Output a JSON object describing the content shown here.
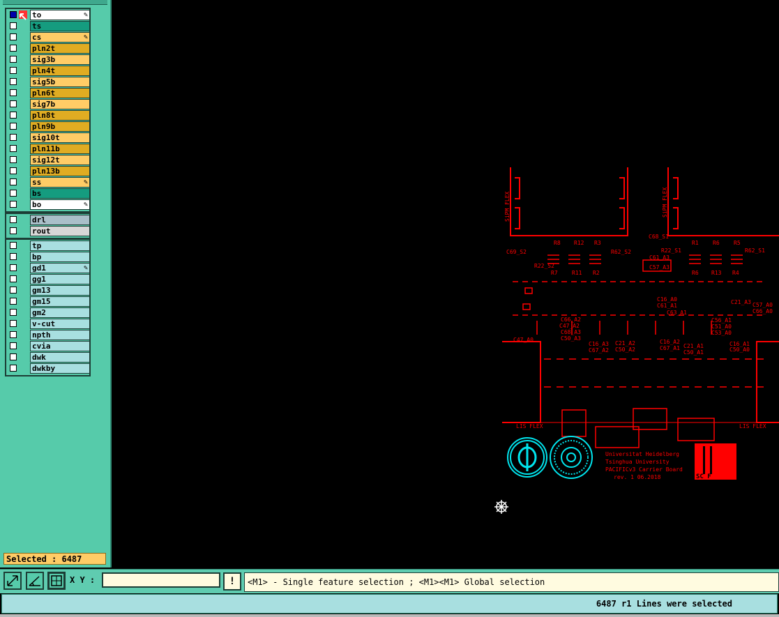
{
  "layers": {
    "board": [
      {
        "name": "to",
        "color": "white",
        "pen": true,
        "active": true
      },
      {
        "name": "ts",
        "color": "teal",
        "pen": false
      },
      {
        "name": "cs",
        "color": "orange1",
        "pen": true
      },
      {
        "name": "pln2t",
        "color": "orange2",
        "pen": false
      },
      {
        "name": "sig3b",
        "color": "orange1",
        "pen": false
      },
      {
        "name": "pln4t",
        "color": "orange2",
        "pen": false
      },
      {
        "name": "sig5b",
        "color": "orange1",
        "pen": false
      },
      {
        "name": "pln6t",
        "color": "orange2",
        "pen": false
      },
      {
        "name": "sig7b",
        "color": "orange1",
        "pen": false
      },
      {
        "name": "pln8t",
        "color": "orange2",
        "pen": false
      },
      {
        "name": "pln9b",
        "color": "orange2",
        "pen": false
      },
      {
        "name": "sig10t",
        "color": "orange1",
        "pen": false
      },
      {
        "name": "pln11b",
        "color": "orange2",
        "pen": false
      },
      {
        "name": "sig12t",
        "color": "orange1",
        "pen": false
      },
      {
        "name": "pln13b",
        "color": "orange2",
        "pen": false
      },
      {
        "name": "ss",
        "color": "orange1",
        "pen": true
      },
      {
        "name": "bs",
        "color": "teal",
        "pen": false
      },
      {
        "name": "bo",
        "color": "white",
        "pen": true
      }
    ],
    "drill": [
      {
        "name": "drl",
        "color": "gray"
      },
      {
        "name": "rout",
        "color": "lgray"
      }
    ],
    "misc": [
      {
        "name": "tp",
        "pen": false
      },
      {
        "name": "bp",
        "pen": false
      },
      {
        "name": "gd1",
        "pen": true
      },
      {
        "name": "gg1",
        "pen": false
      },
      {
        "name": "gm13",
        "pen": false
      },
      {
        "name": "gm15",
        "pen": false
      },
      {
        "name": "gm2",
        "pen": false
      },
      {
        "name": "v-cut",
        "pen": false
      },
      {
        "name": "npth",
        "pen": false
      },
      {
        "name": "cvia",
        "pen": false
      },
      {
        "name": "dwk",
        "pen": false
      },
      {
        "name": "dwkby",
        "pen": false
      }
    ]
  },
  "selected_label": "Selected : 6487",
  "toolbar": {
    "xy_label": "X Y :",
    "xy_value": "",
    "warn_label": "!",
    "hint": "<M1> - Single feature selection ; <M1><M1> Global selection"
  },
  "status": "6487 r1 Lines were selected",
  "pcb": {
    "flex_left": "SiPM FLEX",
    "flex_right": "SiPM FLEX",
    "lis_left": "LIS FLEX",
    "lis_right": "LIS FLEX",
    "logo_text": "SC F",
    "credits": [
      "Universitat Heidelberg",
      "Tsinghua University",
      "PACIFICv3 Carrier Board",
      "rev. 1    06.2018"
    ],
    "refs": [
      "R8",
      "R12",
      "R3",
      "R1",
      "R6",
      "R5",
      "R7",
      "R11",
      "R2",
      "R6",
      "R13",
      "R4",
      "C69_S2",
      "R22_S2",
      "R62_S2",
      "R22_S1",
      "R62_S1",
      "C68_S1",
      "C61_A3",
      "C57_A3",
      "C66_A2",
      "C47_A2",
      "C68_A3",
      "C50_A3",
      "C16_A3",
      "C67_A2",
      "C21_A2",
      "C50_A2",
      "C16_A2",
      "C67_A1",
      "C21_A1",
      "C50_A1",
      "C16_A1",
      "C50_A0",
      "C16_A0",
      "C61_A1",
      "C63_A1",
      "C56_A1",
      "C51_A0",
      "C53_A0",
      "C57_A0",
      "C66_A0",
      "C47_A0",
      "C21_A3"
    ]
  },
  "colors": {
    "trace": "#ff0000",
    "logo": "#00e5ee",
    "panel": "#56cbaa"
  }
}
